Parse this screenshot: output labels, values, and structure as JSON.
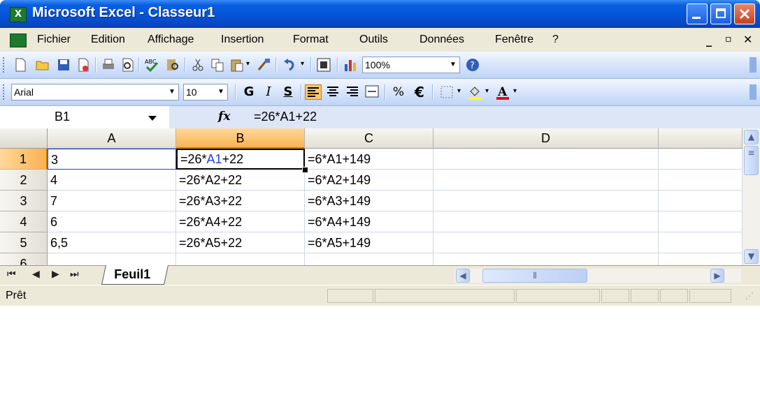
{
  "window": {
    "title": "Microsoft Excel - Classeur1",
    "app_icon": "X"
  },
  "menubar": {
    "items": [
      "Fichier",
      "Edition",
      "Affichage",
      "Insertion",
      "Format",
      "Outils",
      "Données",
      "Fenêtre",
      "?"
    ]
  },
  "toolbar_standard": {
    "zoom": "100%"
  },
  "toolbar_format": {
    "font": "Arial",
    "size": "10",
    "bold": "G",
    "italic": "I",
    "underline": "S",
    "percent": "%",
    "euro": "€"
  },
  "formula_bar": {
    "name_box": "B1",
    "fx": "fx",
    "formula": "=26*A1+22"
  },
  "grid": {
    "columns": [
      "A",
      "B",
      "C",
      "D"
    ],
    "rows": [
      "1",
      "2",
      "3",
      "4",
      "5",
      "6"
    ],
    "cells": [
      [
        "3",
        "=26*A1+22",
        "=6*A1+149",
        ""
      ],
      [
        "4",
        "=26*A2+22",
        "=6*A2+149",
        ""
      ],
      [
        "7",
        "=26*A3+22",
        "=6*A3+149",
        ""
      ],
      [
        "6",
        "=26*A4+22",
        "=6*A4+149",
        ""
      ],
      [
        "6,5",
        "=26*A5+22",
        "=6*A5+149",
        ""
      ],
      [
        "",
        "",
        "",
        ""
      ]
    ],
    "selected_cell": "B1"
  },
  "sheets": {
    "active": "Feuil1"
  },
  "status": {
    "text": "Prêt"
  },
  "colors": {
    "title_blue": "#0554d8",
    "menu_bg": "#ece9d8",
    "selection_orange": "#f9b251",
    "ref_blue": "#1f3fe0"
  }
}
